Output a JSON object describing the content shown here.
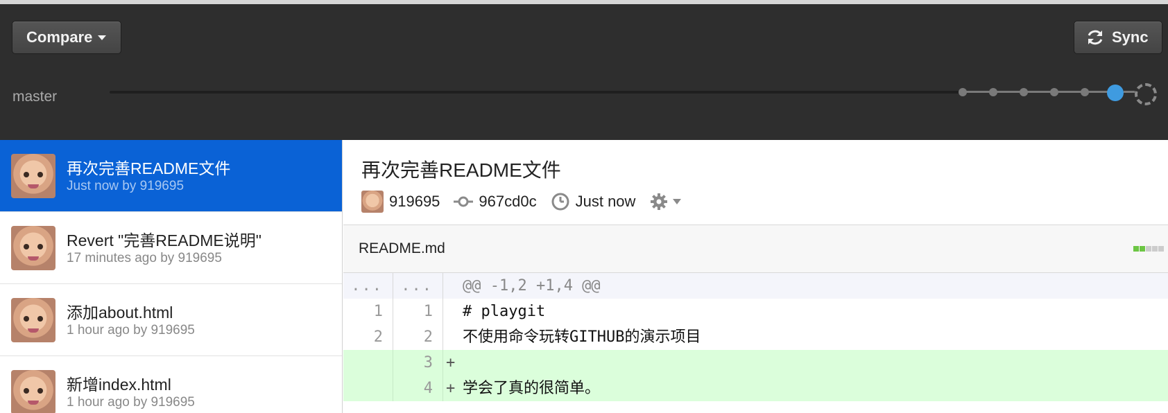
{
  "header": {
    "compare_label": "Compare",
    "sync_label": "Sync",
    "branch": "master"
  },
  "commits": [
    {
      "title": "再次完善README文件",
      "meta": "Just now by 919695",
      "selected": true
    },
    {
      "title": "Revert \"完善README说明\"",
      "meta": "17 minutes ago by 919695",
      "selected": false
    },
    {
      "title": "添加about.html",
      "meta": "1 hour ago by 919695",
      "selected": false
    },
    {
      "title": "新增index.html",
      "meta": "1 hour ago by 919695",
      "selected": false
    }
  ],
  "detail": {
    "title": "再次完善README文件",
    "author": "919695",
    "sha": "967cd0c",
    "time": "Just now"
  },
  "file": {
    "name": "README.md",
    "diffstat_colors": [
      "#6cc644",
      "#6cc644",
      "#cccccc",
      "#cccccc",
      "#cccccc"
    ]
  },
  "diff": [
    {
      "type": "hunk",
      "old": "...",
      "new": "...",
      "text": "@@ -1,2 +1,4 @@"
    },
    {
      "type": "ctx",
      "old": "1",
      "new": "1",
      "text": "# playgit"
    },
    {
      "type": "ctx",
      "old": "2",
      "new": "2",
      "text": "不使用命令玩转GITHUB的演示项目"
    },
    {
      "type": "add",
      "old": "",
      "new": "3",
      "sign": "+",
      "text": ""
    },
    {
      "type": "add",
      "old": "",
      "new": "4",
      "sign": "+",
      "text": "学会了真的很简单。"
    }
  ],
  "colors": {
    "header_bg": "#2e2e2e",
    "selected_bg": "#0a62d6",
    "current_commit": "#3f9be0",
    "added_line_bg": "#dbfedb"
  }
}
